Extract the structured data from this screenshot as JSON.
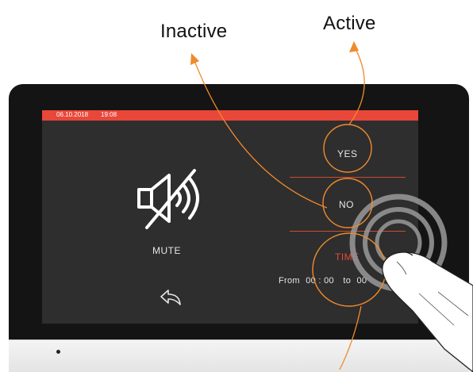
{
  "callouts": {
    "inactive": "Inactive",
    "active": "Active"
  },
  "status_bar": {
    "date": "06.10.2018",
    "time": "19:08",
    "color": "#e8473a"
  },
  "mute_panel": {
    "icon": "speaker-muted-icon",
    "label": "MUTE",
    "back_icon": "back-arrow-icon"
  },
  "options": {
    "yes": "YES",
    "no": "NO",
    "time": "TIME"
  },
  "schedule": {
    "from_label": "From",
    "from_time": "00 : 00",
    "to_label": "to",
    "to_time": "00"
  },
  "colors": {
    "accent": "#e8473a",
    "callout_line": "#f08a2c",
    "screen_bg": "#2e2e2e"
  }
}
